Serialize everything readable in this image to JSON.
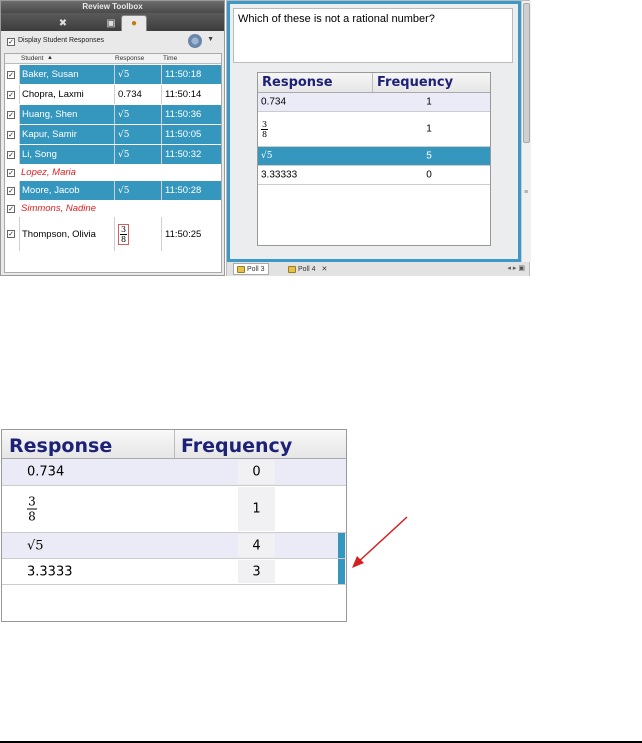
{
  "toolbox": {
    "title": "Review Toolbox",
    "option_label": "Display Student Responses",
    "columns": [
      "Student",
      "Response",
      "Time"
    ],
    "students": [
      {
        "name": "Baker, Susan",
        "response": "√5",
        "time": "11:50:18",
        "selected": true
      },
      {
        "name": "Chopra, Laxmi",
        "response": "0.734",
        "time": "11:50:14",
        "selected": false
      },
      {
        "name": "Huang, Shen",
        "response": "√5",
        "time": "11:50:36",
        "selected": true
      },
      {
        "name": "Kapur, Samir",
        "response": "√5",
        "time": "11:50:05",
        "selected": true
      },
      {
        "name": "Li, Song",
        "response": "√5",
        "time": "11:50:32",
        "selected": true
      },
      {
        "name": "Lopez, Maria",
        "response": "",
        "time": "",
        "selected": false,
        "no_response": true
      },
      {
        "name": "Moore, Jacob",
        "response": "√5",
        "time": "11:50:28",
        "selected": true
      },
      {
        "name": "Simmons, Nadine",
        "response": "",
        "time": "",
        "selected": false,
        "no_response": true
      },
      {
        "name": "Thompson, Olivia",
        "response": "3/8",
        "time": "11:50:25",
        "selected": false
      }
    ]
  },
  "poll": {
    "question": "Which of these is not a rational number?",
    "headers": {
      "response": "Response",
      "frequency": "Frequency"
    },
    "rows": [
      {
        "response": "0.734",
        "frequency": "1"
      },
      {
        "response": "3/8",
        "frequency": "1"
      },
      {
        "response": "√5",
        "frequency": "5"
      },
      {
        "response": "3.33333",
        "frequency": "0"
      }
    ],
    "tabs": [
      "Poll 3",
      "Poll 4"
    ]
  },
  "enlarged": {
    "headers": {
      "response": "Response",
      "frequency": "Frequency"
    },
    "rows": [
      {
        "response": "0.734",
        "frequency": "0"
      },
      {
        "response": "3/8",
        "frequency": "1"
      },
      {
        "response": "√5",
        "frequency": "4"
      },
      {
        "response": "3.3333",
        "frequency": "3"
      }
    ]
  },
  "colors": {
    "accent": "#3697be",
    "header_text": "#1e2277",
    "no_response": "#e02020",
    "arrow": "#d42020"
  }
}
